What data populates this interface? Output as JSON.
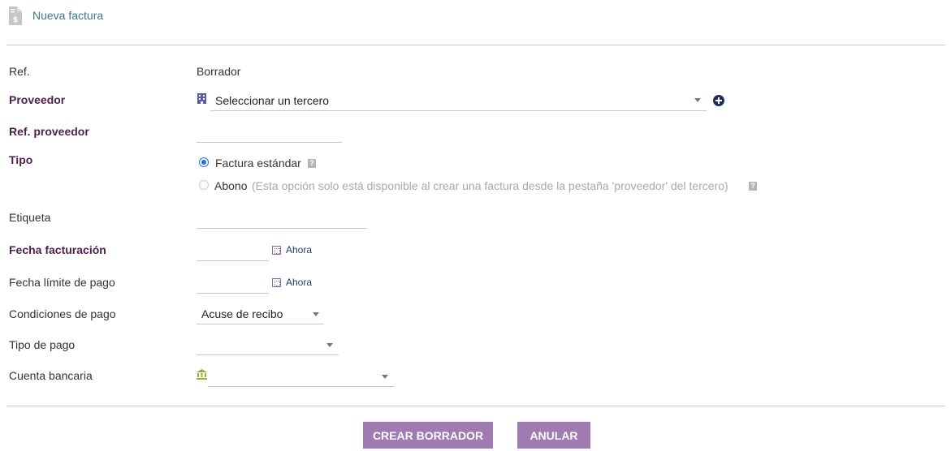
{
  "header": {
    "title": "Nueva factura",
    "icon": "invoice-document-icon"
  },
  "form": {
    "ref": {
      "label": "Ref.",
      "value": "Borrador"
    },
    "proveedor": {
      "label": "Proveedor",
      "selected": "Seleccionar un tercero",
      "icon": "building-icon",
      "add_icon": "plus-circle-icon"
    },
    "ref_proveedor": {
      "label": "Ref. proveedor",
      "value": ""
    },
    "tipo": {
      "label": "Tipo",
      "options": [
        {
          "label": "Factura estándar",
          "checked": true,
          "note": ""
        },
        {
          "label": "Abono",
          "checked": false,
          "note": "(Esta opción solo está disponible al crear una factura desde la pestaña 'proveedor' del tercero)"
        }
      ],
      "help_glyph": "?"
    },
    "etiqueta": {
      "label": "Etiqueta",
      "value": ""
    },
    "fecha_facturacion": {
      "label": "Fecha facturación",
      "value": "",
      "now_label": "Ahora"
    },
    "fecha_limite": {
      "label": "Fecha límite de pago",
      "value": "",
      "now_label": "Ahora"
    },
    "condiciones_pago": {
      "label": "Condiciones de pago",
      "selected": "Acuse de recibo"
    },
    "tipo_pago": {
      "label": "Tipo de pago",
      "selected": ""
    },
    "cuenta_bancaria": {
      "label": "Cuenta bancaria",
      "selected": "",
      "icon": "bank-icon"
    }
  },
  "buttons": {
    "create": "CREAR BORRADOR",
    "cancel": "ANULAR"
  },
  "colors": {
    "accent": "#a07ab0",
    "required_label": "#4d1f4d",
    "title": "#3a7b86",
    "radio": "#1a73e8"
  }
}
